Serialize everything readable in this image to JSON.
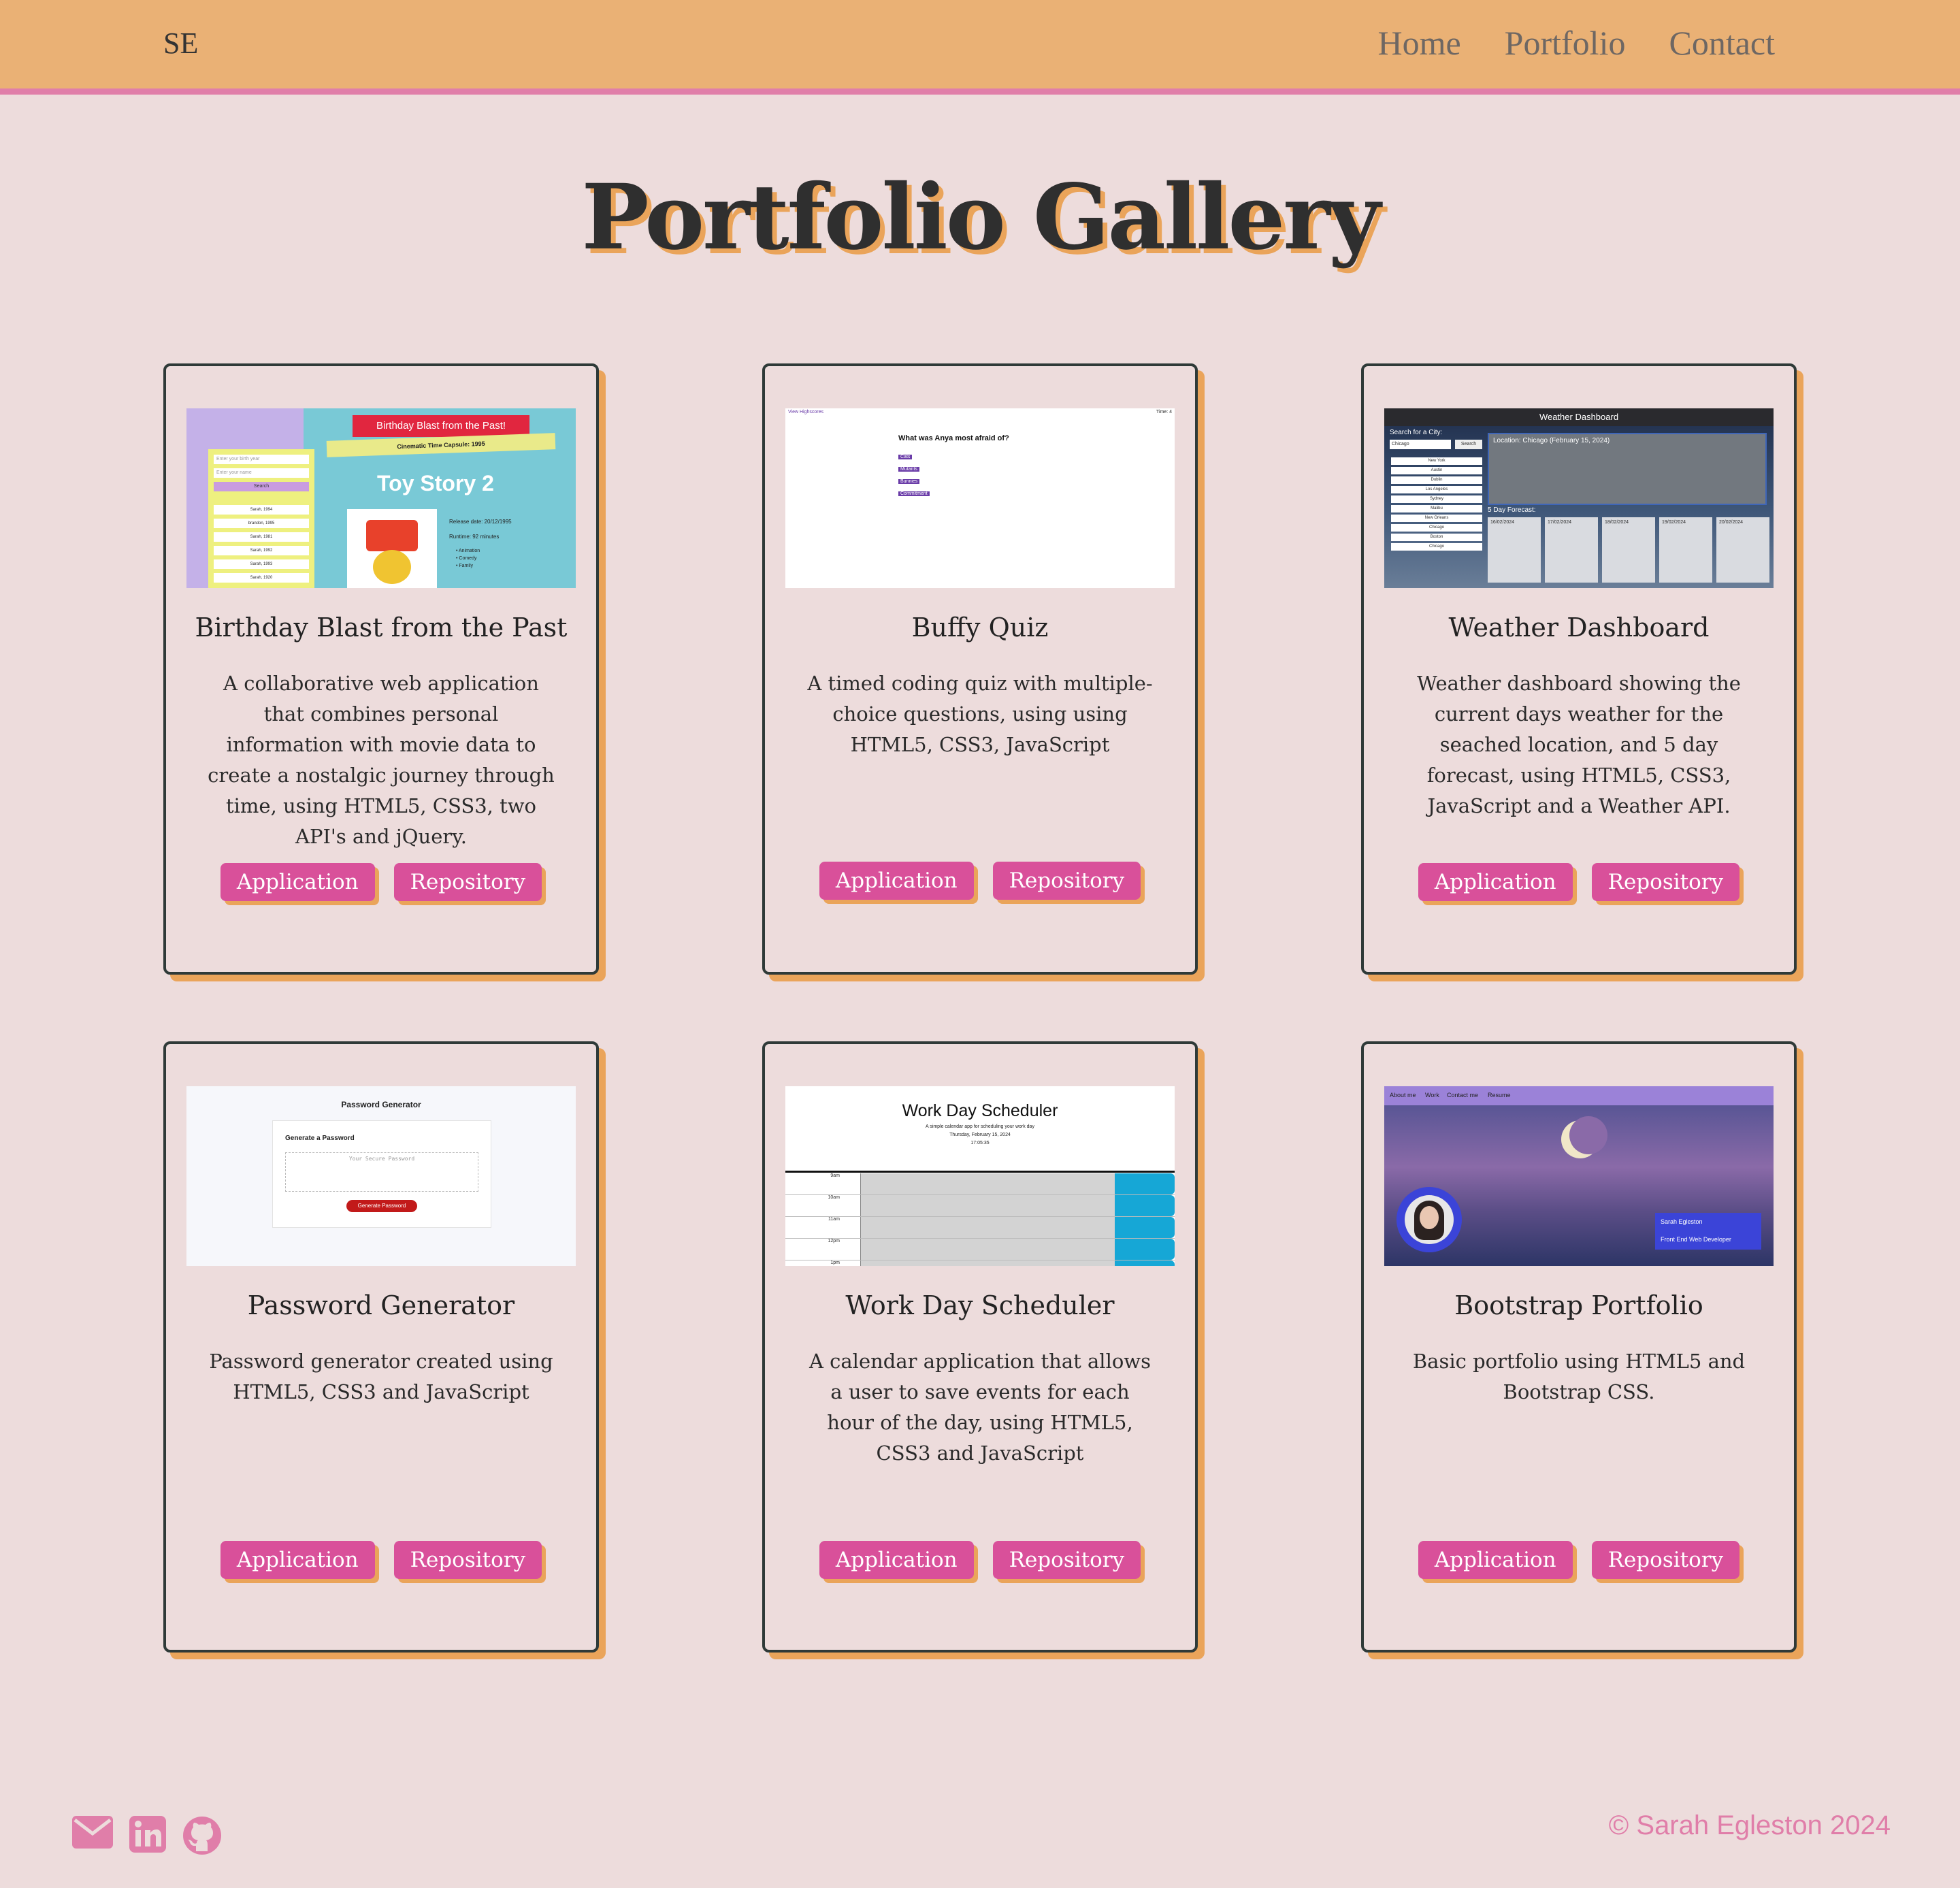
{
  "nav": {
    "brand": "SE",
    "links": [
      "Home",
      "Portfolio",
      "Contact"
    ]
  },
  "page": {
    "title": "Portfolio Gallery"
  },
  "projects": [
    {
      "title": "Birthday Blast from the Past",
      "description": "A collaborative web application that combines personal information with movie data to create a nostalgic journey through time, using HTML5, CSS3, two API's and jQuery.",
      "buttons": [
        "Application",
        "Repository"
      ],
      "thumb": {
        "heading": "Birthday Blast from the Past!",
        "subheading": "Cinematic Time Capsule: 1995",
        "movie": "Toy Story 2",
        "release": "Release date: 20/12/1995",
        "runtime": "Runtime: 92 minutes",
        "genres": [
          "Animation",
          "Comedy",
          "Family"
        ],
        "input1": "Enter your birth year",
        "input2": "Enter your name",
        "search": "Search",
        "history": [
          "Sarah, 1994",
          "brandon, 1995",
          "Sarah, 1981",
          "Sarah, 1992",
          "Sarah, 1993",
          "Sarah, 1920"
        ]
      }
    },
    {
      "title": "Buffy Quiz",
      "description": "A timed coding quiz with multiple-choice questions, using using HTML5, CSS3, JavaScript",
      "buttons": [
        "Application",
        "Repository"
      ],
      "thumb": {
        "highscores": "View Highscores",
        "timer": "Time: 4",
        "question": "What was Anya most afraid of?",
        "answers": [
          "Cats",
          "Mutants",
          "Bunnies",
          "Commitment"
        ]
      }
    },
    {
      "title": "Weather Dashboard",
      "description": "Weather dashboard showing the current days weather for the seached location, and 5 day forecast, using HTML5, CSS3, JavaScript and a Weather API.",
      "buttons": [
        "Application",
        "Repository"
      ],
      "thumb": {
        "header": "Weather Dashboard",
        "search_label": "Search for a City:",
        "search_value": "Chicago",
        "search_button": "Search",
        "location": "Location: Chicago (February 15, 2024)",
        "forecast_label": "5 Day Forecast:",
        "cities": [
          "New York",
          "Austin",
          "Dublin",
          "Los Angeles",
          "Sydney",
          "Malibu",
          "New Orleans",
          "Chicago",
          "Boston",
          "Chicago"
        ],
        "dates": [
          "16/02/2024",
          "17/02/2024",
          "18/02/2024",
          "19/02/2024",
          "20/02/2024"
        ]
      }
    },
    {
      "title": "Password Generator",
      "description": "Password generator created using HTML5, CSS3 and JavaScript",
      "buttons": [
        "Application",
        "Repository"
      ],
      "thumb": {
        "header": "Password Generator",
        "subheader": "Generate a Password",
        "placeholder": "Your Secure Password",
        "button": "Generate Password"
      }
    },
    {
      "title": "Work Day Scheduler",
      "description": "A calendar application that allows a user to save events for each hour of the day, using HTML5, CSS3 and JavaScript",
      "buttons": [
        "Application",
        "Repository"
      ],
      "thumb": {
        "header": "Work Day Scheduler",
        "tagline": "A simple calendar app for scheduling your work day",
        "date": "Thursday, February 15, 2024",
        "time": "17:05:35",
        "hours": [
          "9am",
          "10am",
          "11am",
          "12pm",
          "1pm"
        ]
      }
    },
    {
      "title": "Bootstrap Portfolio",
      "description": "Basic portfolio using HTML5 and Bootstrap CSS.",
      "buttons": [
        "Application",
        "Repository"
      ],
      "thumb": {
        "nav": [
          "About me",
          "Work",
          "Contact me",
          "Resume"
        ],
        "name": "Sarah Egleston",
        "role": "Front End Web Developer"
      }
    }
  ],
  "footer": {
    "icons": [
      "envelope-icon",
      "linkedin-icon",
      "github-icon"
    ],
    "copyright": "© Sarah Egleston 2024"
  },
  "colors": {
    "navbar": "#eab175",
    "nav_border": "#e07ea9",
    "page_bg": "#eddcdc",
    "button": "#d9509a",
    "shadow": "#eaa45a",
    "card_border": "#2f3a38"
  }
}
